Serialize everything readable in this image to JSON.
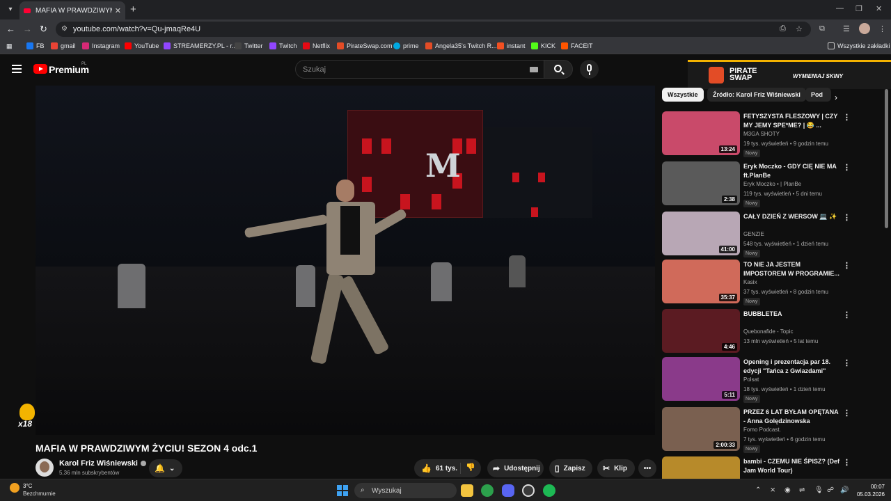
{
  "browser": {
    "tab_title": "MAFIA W PRAWDZIWYM ŻYCIU",
    "url": "youtube.com/watch?v=Qu-jmaqRe4U"
  },
  "bookmarks": [
    {
      "label": "FB",
      "color": "#1877f2"
    },
    {
      "label": "gmail",
      "color": "#ea4335"
    },
    {
      "label": "Instagram",
      "color": "#d62976"
    },
    {
      "label": "YouTube",
      "color": "#ff0000"
    },
    {
      "label": "STREAMERZY.PL - r...",
      "color": "#9146ff"
    },
    {
      "label": "Twitter",
      "color": "#444444"
    },
    {
      "label": "Twitch",
      "color": "#9146ff"
    },
    {
      "label": "Netflix",
      "color": "#e50914"
    },
    {
      "label": "PirateSwap.com",
      "color": "#e34c26"
    },
    {
      "label": "prime",
      "color": "#00a8e1"
    },
    {
      "label": "Angela35's Twitch R...",
      "color": "#e34c26"
    },
    {
      "label": "instant",
      "color": "#f25022"
    },
    {
      "label": "KICK",
      "color": "#53fc18"
    },
    {
      "label": "FACEIT",
      "color": "#ff5500"
    }
  ],
  "all_bookmarks": "Wszystkie zakładki",
  "header": {
    "brand": "Premium",
    "region": "PL",
    "search_placeholder": "Szukaj"
  },
  "ad": {
    "brand": "PIRATE SWAP",
    "cta": "WYMIENIAJ SKINY"
  },
  "video": {
    "age_label": "x18",
    "title": "MAFIA W PRAWDZIWYM ŻYCIU! SEZON 4 odc.1",
    "channel": "Karol Friz Wiśniewski",
    "subscribers": "5,36 mln subskrybentów",
    "likes": "61 tys.",
    "share": "Udostępnij",
    "save": "Zapisz",
    "clip": "Klip"
  },
  "chips": [
    "Wszystkie",
    "Źródło: Karol Friz Wiśniewski",
    "Pod"
  ],
  "recommendations": [
    {
      "title": "FETYSZYSTA FLESZOWY | CZY MY JEMY SPE*ME? | 😂 ...",
      "channel": "M3GA SHOTY",
      "meta": "19 tys. wyświetleń • 9 godzin temu",
      "badge": "Nowy",
      "duration": "13:24",
      "thumb": "#c94a6a"
    },
    {
      "title": "Eryk Moczko - GDY CIĘ NIE MA ft.PlanBe",
      "channel": "Eryk Moczko • | PlanBe",
      "meta": "119 tys. wyświetleń • 5 dni temu",
      "badge": "Nowy",
      "duration": "2:38",
      "thumb": "#5a5a5a"
    },
    {
      "title": "CAŁY DZIEŃ Z WERSOW 💻 ✨",
      "channel": "GENZIE",
      "meta": "548 tys. wyświetleń • 1 dzień temu",
      "badge": "Nowy",
      "duration": "41:00",
      "thumb": "#b8a7b5"
    },
    {
      "title": "TO NIE JA JESTEM IMPOSTOREM W PROGRAMIE...",
      "channel": "Kasix",
      "meta": "37 tys. wyświetleń • 8 godzin temu",
      "badge": "Nowy",
      "duration": "35:37",
      "thumb": "#d06a5a"
    },
    {
      "title": "BUBBLETEA",
      "channel": "Quebonafide - Topic",
      "meta": "13 mln wyświetleń • 5 lat temu",
      "badge": "",
      "duration": "4:46",
      "thumb": "#5b1b22"
    },
    {
      "title": "Opening i prezentacja par 18. edycji \"Tańca z Gwiazdami\"",
      "channel": "Polsat",
      "meta": "18 tys. wyświetleń • 1 dzień temu",
      "badge": "Nowy",
      "duration": "5:11",
      "thumb": "#8a3a8a"
    },
    {
      "title": "PRZEZ 6 LAT BYŁAM OPĘTANA - Anna Golędzinowska",
      "channel": "Fomo Podcast.",
      "meta": "7 tys. wyświetleń • 6 godzin temu",
      "badge": "Nowy",
      "duration": "2:00:33",
      "thumb": "#7a6050"
    },
    {
      "title": "bambi - CZEMU NIE ŚPISZ? (Def Jam World Tour)",
      "channel": "",
      "meta": "",
      "badge": "",
      "duration": "",
      "thumb": "#b78a2a"
    }
  ],
  "taskbar": {
    "weather_temp": "3°C",
    "weather_desc": "Bezchmurnie",
    "search": "Wyszukaj",
    "time": "00:07",
    "date": "05.03.2026"
  }
}
